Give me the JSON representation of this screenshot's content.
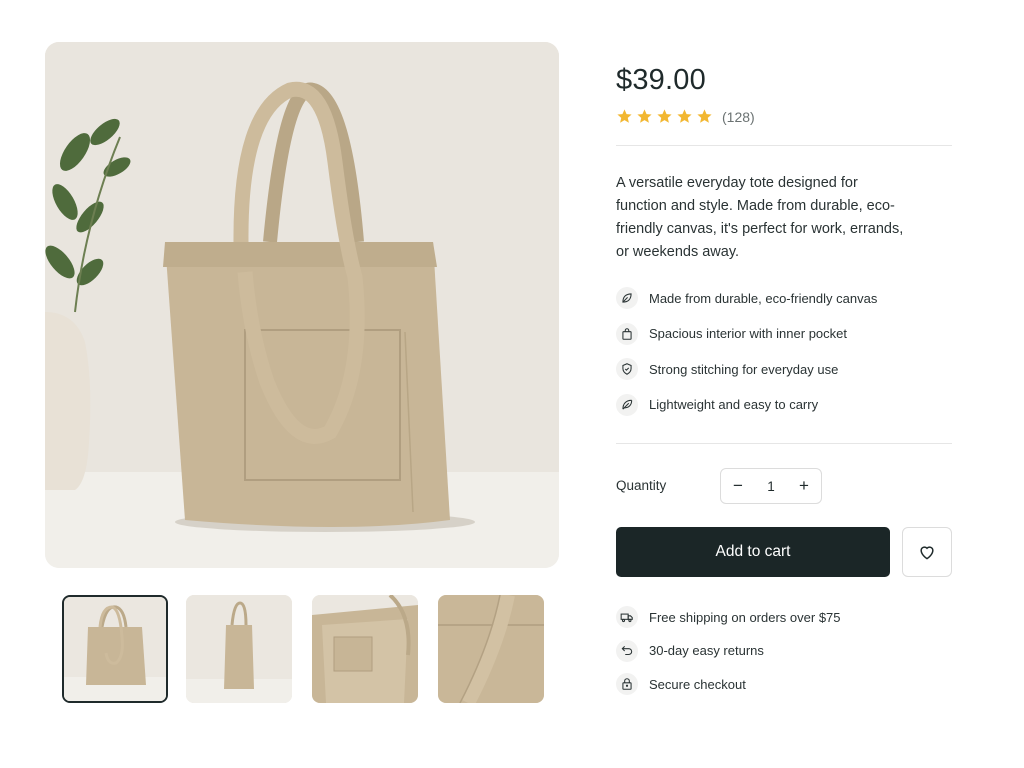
{
  "product": {
    "price": "$39.00",
    "rating": {
      "stars": 5,
      "max_stars": 5,
      "review_count": "(128)"
    },
    "description": "A versatile everyday tote designed for function and style. Made from durable, eco-friendly canvas, it's perfect for work, errands, or weekends away.",
    "features": [
      {
        "icon": "leaf-icon",
        "text": "Made from durable, eco-friendly canvas"
      },
      {
        "icon": "shopping-bag-icon",
        "text": "Spacious interior with inner pocket"
      },
      {
        "icon": "shield-check-icon",
        "text": "Strong stitching for everyday use"
      },
      {
        "icon": "feather-icon",
        "text": "Lightweight and easy to carry"
      }
    ]
  },
  "gallery": {
    "thumbnails": [
      {
        "name": "front-view",
        "selected": true
      },
      {
        "name": "side-view",
        "selected": false
      },
      {
        "name": "interior-view",
        "selected": false
      },
      {
        "name": "detail-view",
        "selected": false
      }
    ]
  },
  "purchase": {
    "quantity_label": "Quantity",
    "quantity": "1",
    "decrement_symbol": "−",
    "increment_symbol": "+",
    "add_to_cart_label": "Add to cart",
    "wishlist_icon": "heart-icon"
  },
  "perks": [
    {
      "icon": "truck-icon",
      "text": "Free shipping on orders over $75"
    },
    {
      "icon": "return-arrow-icon",
      "text": "30-day easy returns"
    },
    {
      "icon": "lock-icon",
      "text": "Secure checkout"
    }
  ],
  "colors": {
    "accent_dark": "#1b2627",
    "star": "#f2b731",
    "canvas": "#c7b597"
  }
}
